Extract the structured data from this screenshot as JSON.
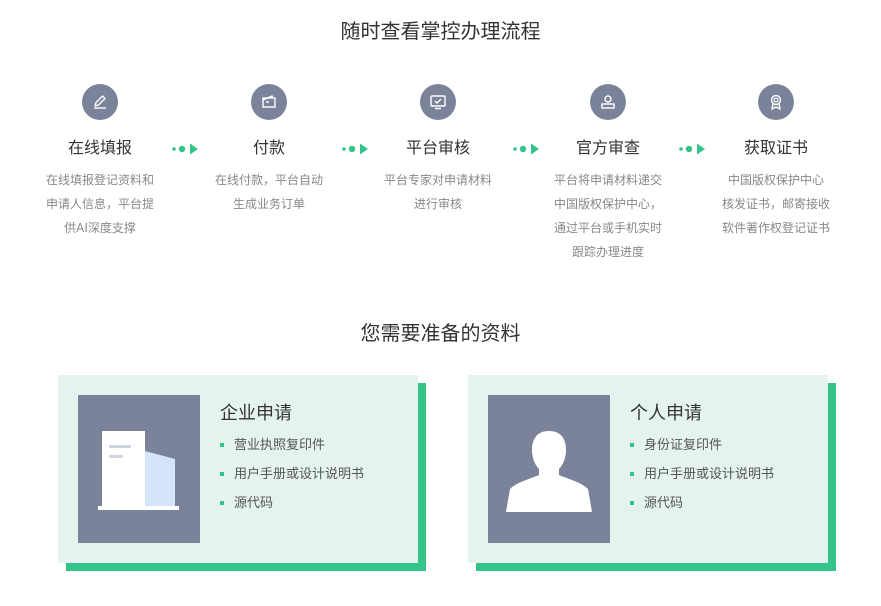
{
  "flow": {
    "title": "随时查看掌控办理流程",
    "steps": [
      {
        "name": "在线填报",
        "icon": "pencil-icon",
        "desc": [
          "在线填报登记资料和",
          "申请人信息，平台提",
          "供AI深度支撑"
        ]
      },
      {
        "name": "付款",
        "icon": "wallet-icon",
        "desc": [
          "在线付款，平台自动",
          "生成业务订单"
        ]
      },
      {
        "name": "平台审核",
        "icon": "monitor-check-icon",
        "desc": [
          "平台专家对申请材料",
          "进行审核"
        ]
      },
      {
        "name": "官方审查",
        "icon": "official-person-icon",
        "desc": [
          "平台将申请材料递交",
          "中国版权保护中心，",
          "通过平台或手机实时",
          "跟踪办理进度"
        ]
      },
      {
        "name": "获取证书",
        "icon": "medal-icon",
        "desc": [
          "中国版权保护中心",
          "核发证书，邮寄接收",
          "软件著作权登记证书"
        ]
      }
    ]
  },
  "materials": {
    "title": "您需要准备的资料",
    "cards": [
      {
        "title": "企业申请",
        "icon": "building-icon",
        "items": [
          "营业执照复印件",
          "用户手册或设计说明书",
          "源代码"
        ]
      },
      {
        "title": "个人申请",
        "icon": "person-silhouette-icon",
        "items": [
          "身份证复印件",
          "用户手册或设计说明书",
          "源代码"
        ]
      }
    ]
  },
  "colors": {
    "accent": "#34c389",
    "icon_bg": "#7a8399",
    "card_bg": "#e4f3ee"
  }
}
